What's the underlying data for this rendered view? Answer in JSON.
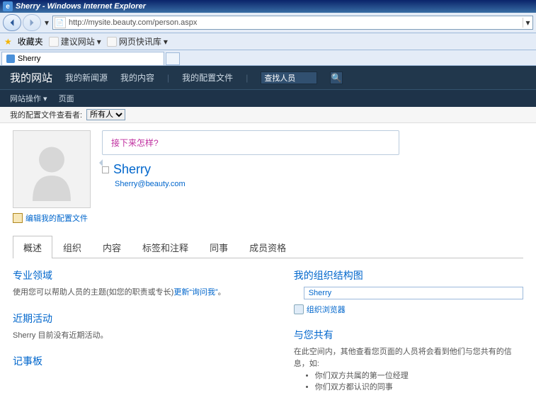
{
  "window_title": "Sherry - Windows Internet Explorer",
  "url": "http://mysite.beauty.com/person.aspx",
  "favbar": {
    "label": "收藏夹",
    "suggest": "建议网站",
    "snap": "网页快讯库"
  },
  "tab_title": "Sherry",
  "ribbon": {
    "site": "我的网站",
    "links": [
      "我的新闻源",
      "我的内容",
      "我的配置文件"
    ],
    "search_placeholder": "查找人员"
  },
  "subrib": {
    "actions": "网站操作",
    "page": "页面"
  },
  "filter": {
    "label": "我的配置文件查看者:",
    "value": "所有人"
  },
  "profile": {
    "bubble": "接下来怎样?",
    "name": "Sherry",
    "email": "Sherry@beauty.com",
    "edit": "编辑我的配置文件"
  },
  "ptabs": [
    "概述",
    "组织",
    "内容",
    "标签和注释",
    "同事",
    "成员资格"
  ],
  "left": {
    "expertise_h": "专业领域",
    "expertise_t1": "使用您可以帮助人员的主题(如您的职责或专长)",
    "expertise_link": "更新“询问我”",
    "expertise_t2": "。",
    "recent_h": "近期活动",
    "recent_t": "Sherry 目前没有近期活动。",
    "note_h": "记事板"
  },
  "right": {
    "org_h": "我的组织结构图",
    "org_name": "Sherry",
    "org_browser": "组织浏览器",
    "shared_h": "与您共有",
    "shared_t": "在此空间内，其他查看您页面的人员将会看到他们与您共有的信息，如:",
    "shared_li1": "你们双方共属的第一位经理",
    "shared_li2": "你们双方都认识的同事"
  }
}
